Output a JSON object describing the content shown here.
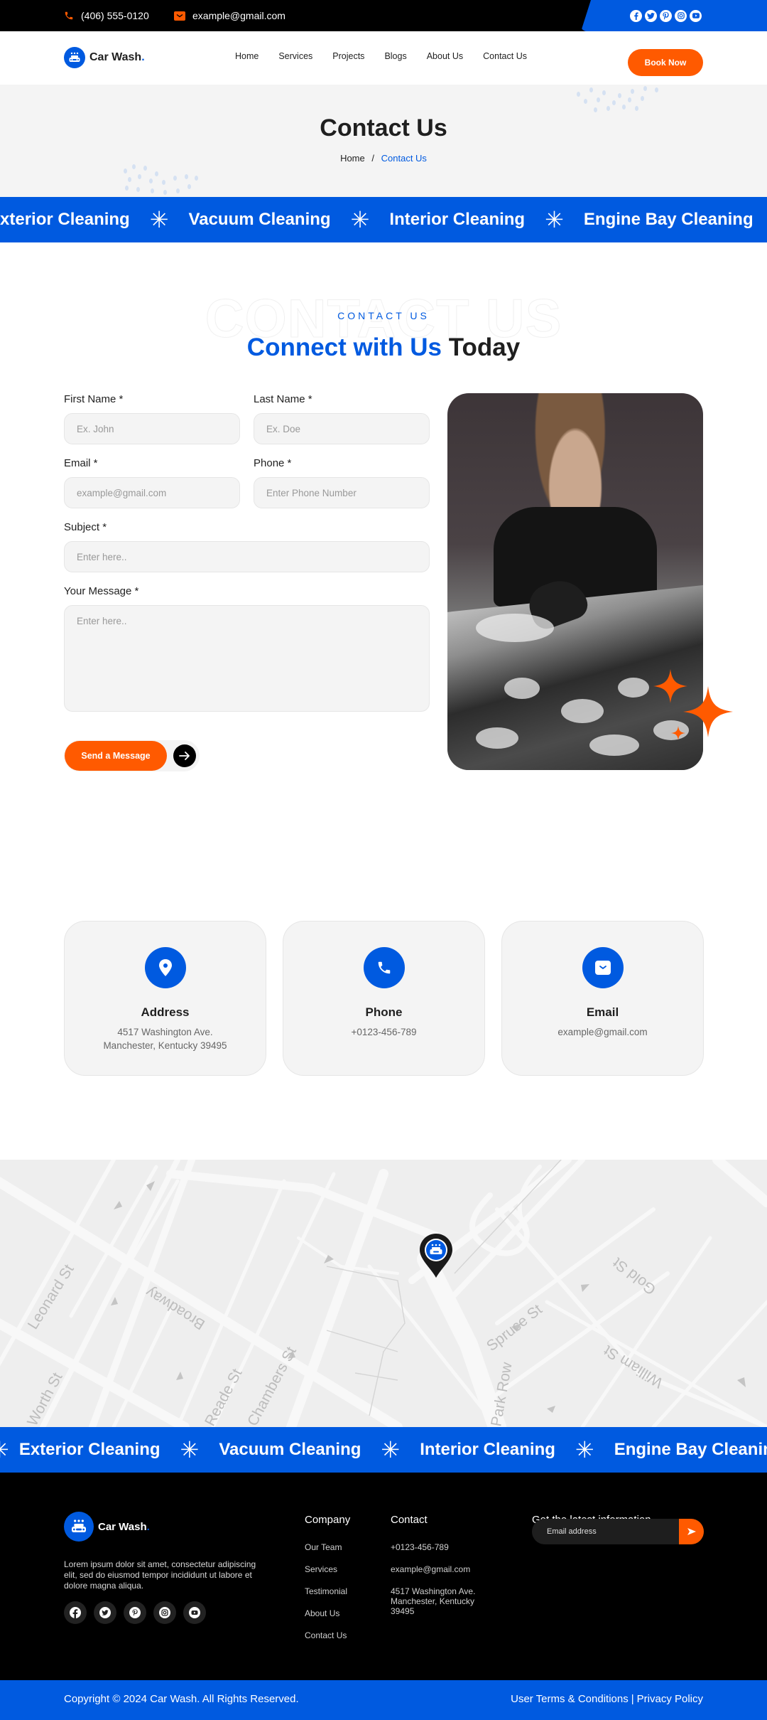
{
  "topbar": {
    "phone": "(406) 555-0120",
    "email": "example@gmail.com",
    "social": [
      "facebook",
      "twitter",
      "pinterest",
      "instagram",
      "youtube"
    ]
  },
  "brand": {
    "name": "Car Wash",
    "dot": "."
  },
  "nav": {
    "links": [
      "Home",
      "Services",
      "Projects",
      "Blogs",
      "About Us",
      "Contact Us"
    ],
    "cta": "Book Now"
  },
  "hero": {
    "title": "Contact Us",
    "breadcrumb": {
      "home": "Home",
      "separator": "/",
      "current": "Contact Us"
    }
  },
  "marquee_top": [
    "Exterior Cleaning",
    "Vacuum Cleaning",
    "Interior Cleaning",
    "Engine Bay Cleaning"
  ],
  "marquee_bottom": [
    "Exterior Cleaning",
    "Vacuum Cleaning",
    "Interior Cleaning",
    "Engine Bay Cleaning"
  ],
  "section": {
    "ghost": "CONTACT US",
    "eyebrow": "CONTACT US",
    "title_blue": "Connect with Us",
    "title_dark": "Today"
  },
  "form": {
    "first_name": {
      "label": "First Name *",
      "placeholder": "Ex. John",
      "value": ""
    },
    "last_name": {
      "label": "Last Name *",
      "placeholder": "Ex. Doe",
      "value": ""
    },
    "email": {
      "label": "Email *",
      "placeholder": "example@gmail.com",
      "value": ""
    },
    "phone": {
      "label": "Phone *",
      "placeholder": "Enter Phone Number",
      "value": ""
    },
    "subject": {
      "label": "Subject *",
      "placeholder": "Enter here..",
      "value": ""
    },
    "message": {
      "label": "Your Message *",
      "placeholder": "Enter here..",
      "value": ""
    },
    "submit": "Send a Message"
  },
  "info_cards": [
    {
      "icon": "location-pin",
      "title": "Address",
      "lines": [
        "4517 Washington Ave.",
        "Manchester, Kentucky 39495"
      ]
    },
    {
      "icon": "phone",
      "title": "Phone",
      "lines": [
        "+0123-456-789"
      ]
    },
    {
      "icon": "envelope",
      "title": "Email",
      "lines": [
        "example@gmail.com"
      ]
    }
  ],
  "map": {
    "street_labels": [
      "Leonard St",
      "Broadway",
      "Worth St",
      "Reade St",
      "Chambers St",
      "Spruce St",
      "Park Row",
      "Gold St",
      "William St"
    ]
  },
  "footer": {
    "description": "Lorem ipsum dolor sit amet, consectetur adipiscing elit, sed do eiusmod tempor incididunt ut labore et dolore magna aliqua.",
    "social": [
      "facebook",
      "twitter",
      "pinterest",
      "instagram",
      "youtube"
    ],
    "company": {
      "heading": "Company",
      "links": [
        "Our Team",
        "Services",
        "Testimonial",
        "About Us",
        "Contact Us"
      ]
    },
    "contact": {
      "heading": "Contact",
      "phone": "+0123-456-789",
      "email": "example@gmail.com",
      "address": "4517 Washington Ave. Manchester, Kentucky 39495"
    },
    "newsletter": {
      "heading": "Get the latest information",
      "placeholder": "Email address"
    }
  },
  "copyright": {
    "text": "Copyright © 2024 Car Wash. All Rights Reserved.",
    "terms": "User Terms & Conditions",
    "divider": "|",
    "privacy": "Privacy Policy"
  },
  "colors": {
    "primary": "#005ae0",
    "accent": "#ff5a00",
    "dark": "#000000",
    "surface": "#f4f4f4"
  }
}
